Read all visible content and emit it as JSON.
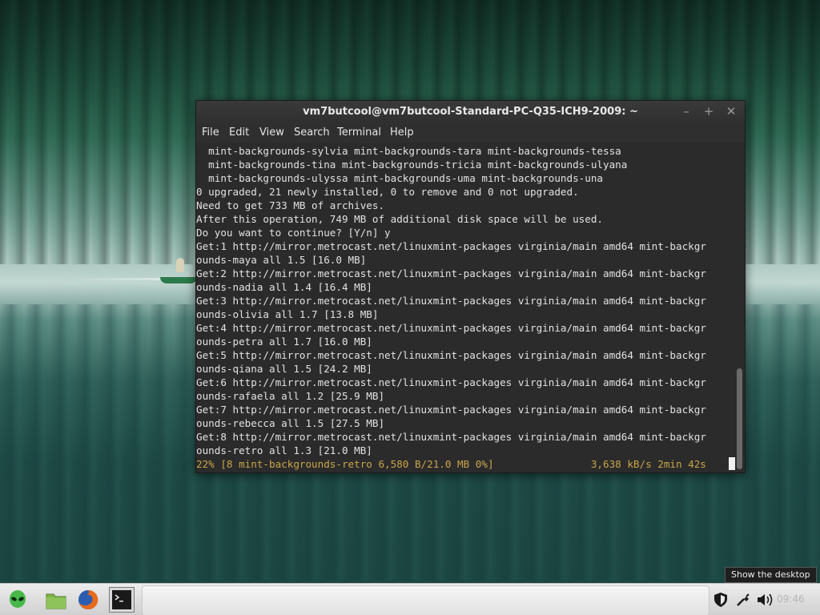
{
  "window": {
    "title": "vm7butcool@vm7butcool-Standard-PC-Q35-ICH9-2009: ~",
    "controls": {
      "minimize": "–",
      "maximize": "+",
      "close": "✕"
    }
  },
  "menubar": [
    "File",
    "Edit",
    "View",
    "Search",
    "Terminal",
    "Help"
  ],
  "terminal": {
    "lines": [
      "  mint-backgrounds-sylvia mint-backgrounds-tara mint-backgrounds-tessa",
      "  mint-backgrounds-tina mint-backgrounds-tricia mint-backgrounds-ulyana",
      "  mint-backgrounds-ulyssa mint-backgrounds-uma mint-backgrounds-una",
      "0 upgraded, 21 newly installed, 0 to remove and 0 not upgraded.",
      "Need to get 733 MB of archives.",
      "After this operation, 749 MB of additional disk space will be used.",
      "Do you want to continue? [Y/n] y",
      "Get:1 http://mirror.metrocast.net/linuxmint-packages virginia/main amd64 mint-backgr",
      "ounds-maya all 1.5 [16.0 MB]",
      "Get:2 http://mirror.metrocast.net/linuxmint-packages virginia/main amd64 mint-backgr",
      "ounds-nadia all 1.4 [16.4 MB]",
      "Get:3 http://mirror.metrocast.net/linuxmint-packages virginia/main amd64 mint-backgr",
      "ounds-olivia all 1.7 [13.8 MB]",
      "Get:4 http://mirror.metrocast.net/linuxmint-packages virginia/main amd64 mint-backgr",
      "ounds-petra all 1.7 [16.0 MB]",
      "Get:5 http://mirror.metrocast.net/linuxmint-packages virginia/main amd64 mint-backgr",
      "ounds-qiana all 1.5 [24.2 MB]",
      "Get:6 http://mirror.metrocast.net/linuxmint-packages virginia/main amd64 mint-backgr",
      "ounds-rafaela all 1.2 [25.9 MB]",
      "Get:7 http://mirror.metrocast.net/linuxmint-packages virginia/main amd64 mint-backgr",
      "ounds-rebecca all 1.5 [27.5 MB]",
      "Get:8 http://mirror.metrocast.net/linuxmint-packages virginia/main amd64 mint-backgr",
      "ounds-retro all 1.3 [21.0 MB]"
    ],
    "progress_line": "22% [8 mint-backgrounds-retro 6,580 B/21.0 MB 0%]                3,638 kB/s 2min 42s"
  },
  "taskbar": {
    "launchers": [
      "menu-icon",
      "files-icon",
      "firefox-icon",
      "terminal-icon"
    ],
    "tooltip": "Show the desktop",
    "clock": "09:46",
    "tray_icons": [
      "shield-icon",
      "network-icon",
      "volume-icon"
    ]
  },
  "colors": {
    "terminal_bg": "#2b2b2b",
    "terminal_fg": "#e2e2e2",
    "progress_fg": "#c9a64a"
  }
}
